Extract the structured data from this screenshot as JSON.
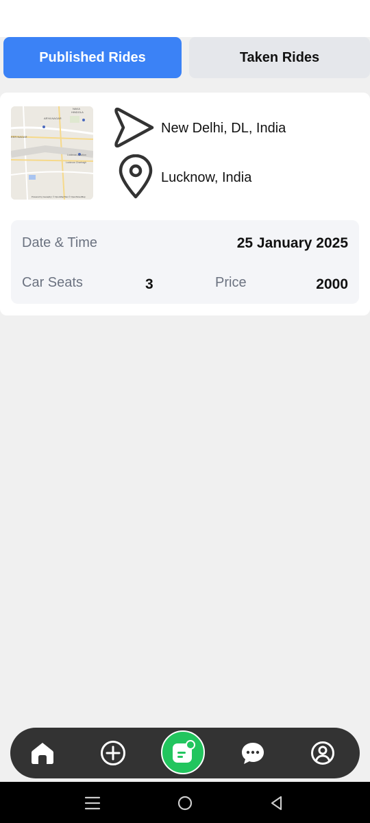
{
  "tabs": {
    "published_label": "Published Rides",
    "taken_label": "Taken Rides"
  },
  "ride": {
    "from": "New Delhi, DL, India",
    "to": "Lucknow, India",
    "date_label": "Date & Time",
    "date_value": "25 January 2025",
    "seats_label": "Car Seats",
    "seats_value": "3",
    "price_label": "Price",
    "price_value": "2000",
    "map": {
      "labels": [
        "NAKA",
        "HINDOLA",
        "ARYA NAGAR",
        "EER NAGAR",
        "Lucknow Junction",
        "Lucknow Charbagh"
      ],
      "attribution": "Powered by Geoapify | © OpenMapTiles © OpenStreetMap"
    }
  },
  "nav": {
    "items": [
      "home-icon",
      "add-circle-icon",
      "rides-icon",
      "chat-icon",
      "profile-icon"
    ]
  },
  "system_nav": {
    "items": [
      "recent-apps-icon",
      "home-circle-icon",
      "back-triangle-icon"
    ]
  },
  "colors": {
    "accent_blue": "#3b82f6",
    "accent_green": "#22c55e",
    "nav_background": "#333333",
    "tab_inactive": "#e5e7eb"
  }
}
